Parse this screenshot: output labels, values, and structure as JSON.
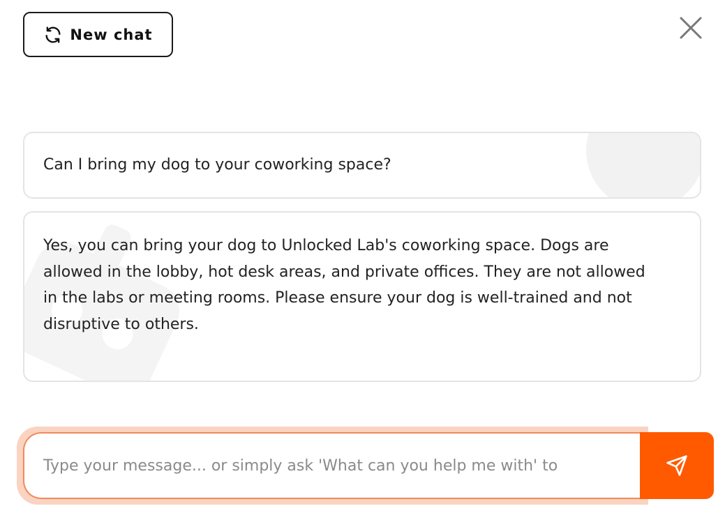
{
  "header": {
    "new_chat_label": "New chat",
    "new_chat_icon": "refresh-icon",
    "close_icon": "close-icon"
  },
  "messages": [
    {
      "role": "user",
      "text": "Can I bring my dog to your coworking space?"
    },
    {
      "role": "assistant",
      "text": "Yes, you can bring your dog to Unlocked Lab's coworking space. Dogs are allowed in the lobby, hot desk areas, and private offices. They are not allowed in the labs or meeting rooms. Please ensure your dog is well-trained and not disruptive to others."
    }
  ],
  "composer": {
    "placeholder": "Type your message... or simply ask 'What can you help me with' to",
    "send_icon": "send-icon"
  },
  "colors": {
    "accent": "#ff5a00",
    "input_border": "#f08a5c",
    "input_glow": "#fbd3c1",
    "bubble_border": "#e4e4e4"
  }
}
